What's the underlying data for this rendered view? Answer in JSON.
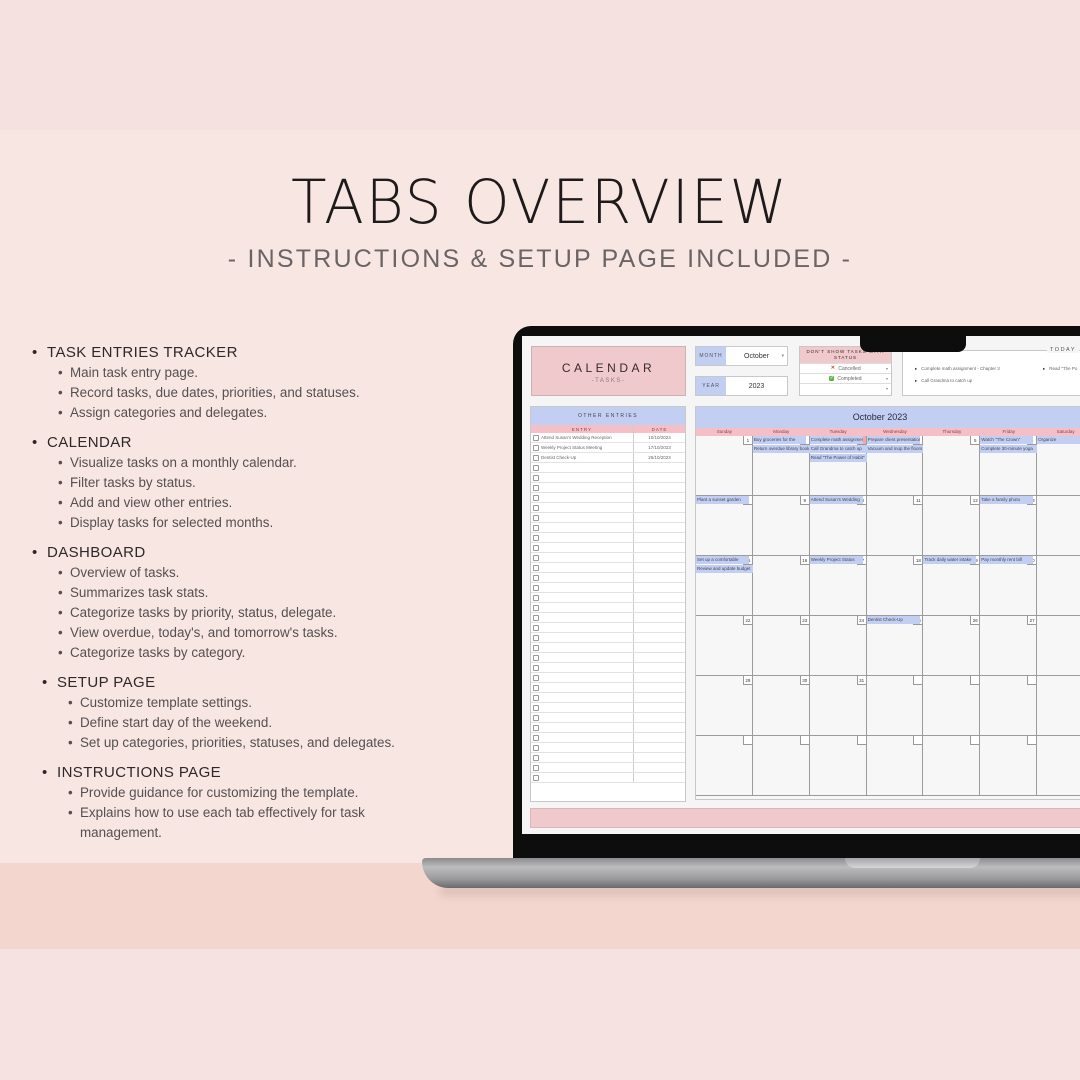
{
  "header": {
    "title": "TABS OVERVIEW",
    "subtitle": "- INSTRUCTIONS & SETUP PAGE INCLUDED -"
  },
  "features": [
    {
      "title": "TASK ENTRIES TRACKER",
      "items": [
        "Main task entry page.",
        "Record tasks, due dates, priorities, and statuses.",
        "Assign categories and delegates."
      ]
    },
    {
      "title": "CALENDAR",
      "items": [
        "Visualize tasks on a monthly calendar.",
        "Filter tasks by status.",
        "Add and view other entries.",
        "Display tasks for selected months."
      ]
    },
    {
      "title": "DASHBOARD",
      "items": [
        "Overview of tasks.",
        "Summarizes task stats.",
        "Categorize tasks by priority, status, delegate.",
        "View overdue, today's, and tomorrow's tasks.",
        "Categorize tasks by category."
      ]
    },
    {
      "title": "SETUP PAGE",
      "items": [
        "Customize template settings.",
        "Define start day of the weekend.",
        "Set up categories, priorities, statuses, and delegates."
      ]
    },
    {
      "title": "INSTRUCTIONS PAGE",
      "items": [
        "Provide guidance for customizing the template.",
        "Explains how to use each tab effectively for task management."
      ]
    }
  ],
  "screen": {
    "sheet_title": "CALENDAR",
    "sheet_subtitle": "-TASKS-",
    "month_label": "MONTH",
    "month_value": "October",
    "year_label": "YEAR",
    "year_value": "2023",
    "status_filter": {
      "header": "DON'T SHOW TASKS WITH STATUS",
      "rows": [
        {
          "icon": "x-icon",
          "label": "Cancelled"
        },
        {
          "icon": "check-icon",
          "label": "Completed"
        },
        {
          "icon": "",
          "label": ""
        }
      ]
    },
    "today": {
      "label": "TODAY",
      "items": [
        "Complete math assignment - Chapter 3",
        "Call Grandma to catch up",
        "Read \"The Po"
      ]
    },
    "other_entries": {
      "header": "OTHER ENTRIES",
      "col_entry": "ENTRY",
      "col_date": "DATE",
      "rows": [
        {
          "entry": "Attend Susan's Wedding Reception",
          "date": "10/10/2023"
        },
        {
          "entry": "Weekly Project Status Meeting",
          "date": "17/10/2023"
        },
        {
          "entry": "Dentist Check-Up",
          "date": "25/10/2023"
        }
      ],
      "empty_rows": 32
    },
    "calendar": {
      "title": "October 2023",
      "weekdays": [
        "Sunday",
        "Monday",
        "Tuesday",
        "Wednesday",
        "Thursday",
        "Friday",
        "Saturday"
      ],
      "today_day": 3,
      "weeks": [
        [
          {
            "day": "1",
            "tasks": []
          },
          {
            "day": "2",
            "tasks": [
              "Buy groceries for the",
              "Return overdue library book"
            ]
          },
          {
            "day": "3",
            "tasks": [
              "Complete math assignment",
              "Call Grandma to catch up",
              "Read \"The Power of Habit\""
            ]
          },
          {
            "day": "4",
            "tasks": [
              "Prepare client presentation",
              "Vacuum and mop the floors"
            ]
          },
          {
            "day": "5",
            "tasks": []
          },
          {
            "day": "6",
            "tasks": [
              "Watch \"The Crown\"",
              "Complete 30-minute yoga"
            ]
          },
          {
            "day": "7",
            "tasks": [
              "Organize"
            ]
          }
        ],
        [
          {
            "day": "8",
            "tasks": [
              "Plant a sunset garden"
            ]
          },
          {
            "day": "9",
            "tasks": []
          },
          {
            "day": "10",
            "tasks": [
              "Attend Susan's Wedding"
            ]
          },
          {
            "day": "11",
            "tasks": []
          },
          {
            "day": "12",
            "tasks": []
          },
          {
            "day": "13",
            "tasks": [
              "Take a family photo"
            ]
          },
          {
            "day": "14",
            "tasks": []
          }
        ],
        [
          {
            "day": "15",
            "tasks": [
              "Set up a comfortable",
              "Review and update budget"
            ]
          },
          {
            "day": "16",
            "tasks": []
          },
          {
            "day": "17",
            "tasks": [
              "Weekly Project Status"
            ]
          },
          {
            "day": "18",
            "tasks": []
          },
          {
            "day": "19",
            "tasks": [
              "Track daily water intake"
            ]
          },
          {
            "day": "20",
            "tasks": [
              "Pay monthly rent bill"
            ]
          },
          {
            "day": "21",
            "tasks": []
          }
        ],
        [
          {
            "day": "22",
            "tasks": []
          },
          {
            "day": "23",
            "tasks": []
          },
          {
            "day": "24",
            "tasks": []
          },
          {
            "day": "25",
            "tasks": [
              "Dentist Check-Up"
            ]
          },
          {
            "day": "26",
            "tasks": []
          },
          {
            "day": "27",
            "tasks": []
          },
          {
            "day": "28",
            "tasks": []
          }
        ],
        [
          {
            "day": "29",
            "tasks": []
          },
          {
            "day": "30",
            "tasks": []
          },
          {
            "day": "31",
            "tasks": []
          },
          {
            "day": "",
            "tasks": []
          },
          {
            "day": "",
            "tasks": []
          },
          {
            "day": "",
            "tasks": []
          },
          {
            "day": "",
            "tasks": []
          }
        ],
        [
          {
            "day": "",
            "tasks": []
          },
          {
            "day": "",
            "tasks": []
          },
          {
            "day": "",
            "tasks": []
          },
          {
            "day": "",
            "tasks": []
          },
          {
            "day": "",
            "tasks": []
          },
          {
            "day": "",
            "tasks": []
          },
          {
            "day": "",
            "tasks": []
          }
        ]
      ]
    }
  }
}
